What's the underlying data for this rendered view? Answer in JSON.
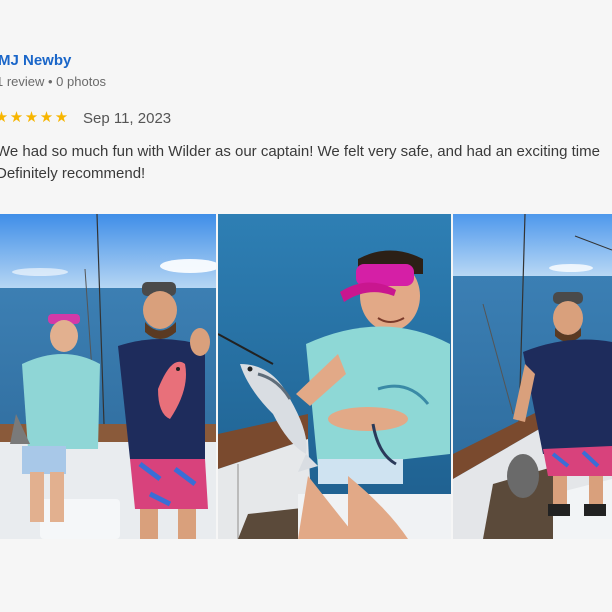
{
  "review": {
    "reviewer_name": "MJ Newby",
    "reviewer_meta": "1 review • 0 photos",
    "rating": 5,
    "date": "Sep 11, 2023",
    "text_lines": [
      "We had so much fun with Wilder as our captain! We felt very safe, and had an exciting time",
      "Definitely recommend!"
    ]
  },
  "icons": {
    "star": "star-icon"
  },
  "colors": {
    "name_link": "#1a66c9",
    "star": "#f7b500",
    "background": "#f6f6f6",
    "text": "#3a3a3a",
    "meta": "#6b6b6b"
  },
  "photos": [
    {
      "subject": "two-people-holding-fish"
    },
    {
      "subject": "woman-holding-fish"
    },
    {
      "subject": "man-on-boat"
    }
  ]
}
